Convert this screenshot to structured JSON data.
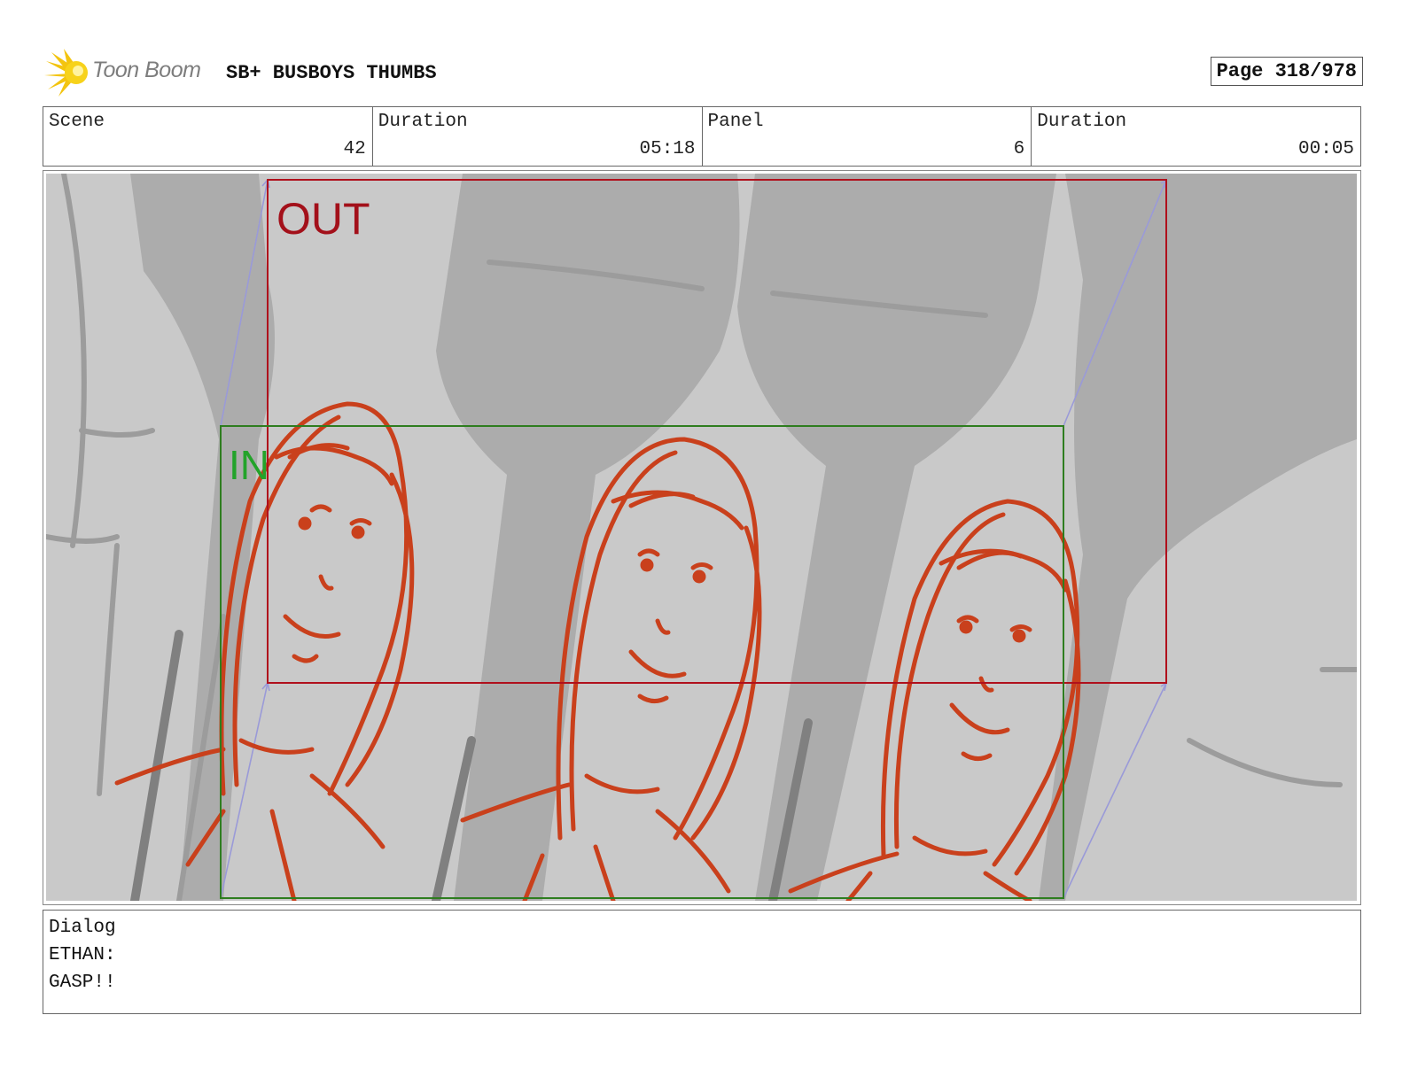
{
  "header": {
    "logo_text": "Toon Boom",
    "title": "SB+ BUSBOYS THUMBS",
    "page": "Page 318/978"
  },
  "info": {
    "scene_label": "Scene",
    "scene_value": "42",
    "scene_duration_label": "Duration",
    "scene_duration_value": "05:18",
    "panel_label": "Panel",
    "panel_value": "6",
    "panel_duration_label": "Duration",
    "panel_duration_value": "00:05"
  },
  "panel": {
    "out_label": "OUT",
    "in_label": "IN",
    "colors": {
      "background": "#c9c9c9",
      "bottle": "#a9a9a9",
      "sketch": "#c9401c",
      "out_frame": "#b0101c",
      "in_frame": "#2e7d1f",
      "motion_arrow": "#9a9ad8"
    }
  },
  "dialog": {
    "label": "Dialog",
    "speaker": "ETHAN:",
    "line": "GASP!!"
  }
}
